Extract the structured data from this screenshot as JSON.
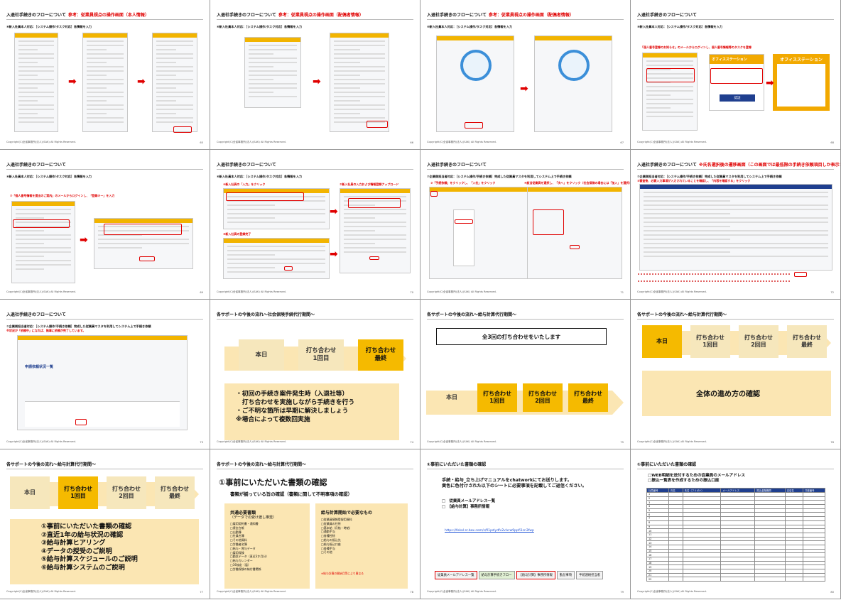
{
  "footer": "Copyright(C)全省事務所(法人)(SAK) All Rights Reserved.",
  "slides": [
    {
      "title": "入退社手続きのフローについて",
      "title_red": "参考：従業員視点の操作画面（本人情報）",
      "subtitle": "⑥新入社員本人対応：［システム操作/タスク対応］各情報を入力",
      "num": "65"
    },
    {
      "title": "入退社手続きのフローについて",
      "title_red": "参考：従業員視点の操作画面（配偶者情報）",
      "subtitle": "⑥新入社員本人対応：［システム操作/タスク対応］各情報を入力",
      "num": "66"
    },
    {
      "title": "入退社手続きのフローについて",
      "title_red": "参考：従業員視点の操作画面（配偶者情報）",
      "subtitle": "⑥新入社員本人対応：［システム操作/タスク対応］各情報を入力",
      "num": "67"
    },
    {
      "title": "入退社手続きのフローについて",
      "subtitle": "⑥新入社員本人対応：［システム操作/タスク対応］各情報を入力",
      "note": "「個人番号登録のお知らせ」のメールからログインし、個人番号情報等のタスクを登録",
      "brand_small": "オフィスステーション",
      "brand_big": "オフィスステーション",
      "login_btn": "認証",
      "num": "68"
    },
    {
      "title": "入退社手続きのフローについて",
      "subtitle": "⑥新入社員本人対応：［システム操作/タスク対応］各情報を入力",
      "note": "⑦「個人番号情報を提出のご案内」のメールからログインし、「登録キー」を入力",
      "num": "69"
    },
    {
      "title": "入退社手続きのフローについて",
      "subtitle": "⑥新入社員本人対応：［システム操作/タスク対応］各情報を入力",
      "note_a": "⑥新入社員の「入力」をクリック",
      "note_b": "⑦新入社員の入力および情報登録アップロード",
      "note_c": "⑧新入社員の登録完了",
      "num": "70"
    },
    {
      "title": "入退社手続きのフローについて",
      "subtitle": "⑦企業側担当者対応：［システム操作/手続き依頼］完成した従業員マスタを利用してシステム上で手続き依頼",
      "note_a": "③「手続依頼」をクリックし、「入社」をクリック",
      "note_b": "④該当従業員を選択し、「次へ」をクリック（社会保険の場合には「加入」を選択）",
      "num": "71"
    },
    {
      "title": "入退社手続きのフローについて",
      "title_red": "※氏名選択後の遷移画面（この画面では最低限の手続き依頼項目しか表示されない）",
      "subtitle": "⑦企業側担当者対応：［システム操作/手続き依頼］完成した従業員マスタを利用してシステム上で手続き依頼",
      "note": "⑤審査後、必要入力事項が入力されていることを確認し、「内容を確認する」をクリック",
      "num": "72"
    },
    {
      "title": "入退社手続きのフローについて",
      "subtitle": "⑦企業側担当者対応：［システム操作/手続き依頼］完成した従業員マスタを利用してシステム上で手続き依頼",
      "note": "※状況が「依頼中」になれば、無事に依頼が完了しています。",
      "screen_title": "申請依頼状況一覧",
      "num": "73"
    },
    {
      "title": "各サポートの今後の流れ～社会保険手続代行期間～",
      "steps": [
        "本日",
        "打ち合わせ\n1回目",
        "打ち合わせ\n最終"
      ],
      "body": "・初回の手続き案件発生時（入退社等）\n　打ち合わせを実施しながら手続きを行う\n・ご不明な箇所は早期に解決しましょう\n※場合によって複数回実施",
      "num": "74"
    },
    {
      "title": "各サポートの今後の流れ～給与計算代行期間～",
      "box": "全3回の打ち合わせをいたします",
      "steps": [
        "本日",
        "打ち合わせ\n1回目",
        "打ち合わせ\n2回目",
        "打ち合わせ\n最終"
      ],
      "num": "75"
    },
    {
      "title": "各サポートの今後の流れ～給与計算代行期間～",
      "steps": [
        "本日",
        "打ち合わせ\n1回目",
        "打ち合わせ\n2回目",
        "打ち合わせ\n最終"
      ],
      "body": "全体の進め方の確認",
      "num": "76"
    },
    {
      "title": "各サポートの今後の流れ～給与計算代行期間～",
      "steps": [
        "本日",
        "打ち合わせ\n1回目",
        "打ち合わせ\n2回目",
        "打ち合わせ\n最終"
      ],
      "body": "①事前にいただいた書類の確認\n②直近1年の給与状況の確認\n③給与計算ヒアリング\n④データの授受のご説明\n⑤給与計算スケジュールのご説明\n⑥給与計算システムのご説明",
      "num": "77"
    },
    {
      "title": "各サポートの今後の流れ～給与計算代行期間～",
      "heading": "①事前にいただいた書類の確認",
      "sub": "書類が揃っている旨の確認（書類に関して不明事項の確認）",
      "left_title": "共通必要書類",
      "left_sub": "（データでの受け渡し推奨）",
      "left_items": "□雇用契約書・通知書\n□賃金台帳\n□出勤簿\n□社員名簿\n□その他資料\n□労働者名簿\n□給与・賞与データ\n□雇用保険\n□勤怠データ（直近3か月分）\n□給与カレンダー\n□36協定（届）\n□労働保険の納付書関係",
      "right_title": "給与計算開始で必要なもの",
      "right_items": "□従業員情報登録用資料\n□従業員の住所\n□基本給（月給・時給）\n□通勤手当\n□各種控除\n□給与の振込先\n□給与振込口座\n□各種手当\n□その他",
      "right_note": "※給与計算の開始月等により異なる",
      "num": "78"
    },
    {
      "title": "①事前にいただいた書類の確認",
      "lead": "手続・給与_立ち上げマニュアルをchatworkにてお送りします。\n黄色に色付けされた以下のシートに必要事項を記載してご返信ください。",
      "checks": [
        "□　従業員メールアドレス一覧",
        "□　【給与計算】事務所情報"
      ],
      "url": "https://fokal-sr.box.com/s/fi1pzlydfv2vlxrw9ppfi1cn3fwp",
      "tabs": [
        "従業員メールアドレス一覧",
        "給与計算手続きフロー",
        "【給与計算】事務所情報",
        "勤怠事項",
        "手続連絡担当者"
      ],
      "num": "79"
    },
    {
      "title": "①事前にいただいた書類の確認",
      "lead": "□WEB明細を送付するための従業員のメールアドレス\n□振込一覧表を作成するための振込口座",
      "columns": [
        "社員番号",
        "氏名",
        "氏名（フリガナ）",
        "メールアドレス",
        "振込金融機関",
        "支店名",
        "口座番号"
      ],
      "num": "80"
    }
  ]
}
